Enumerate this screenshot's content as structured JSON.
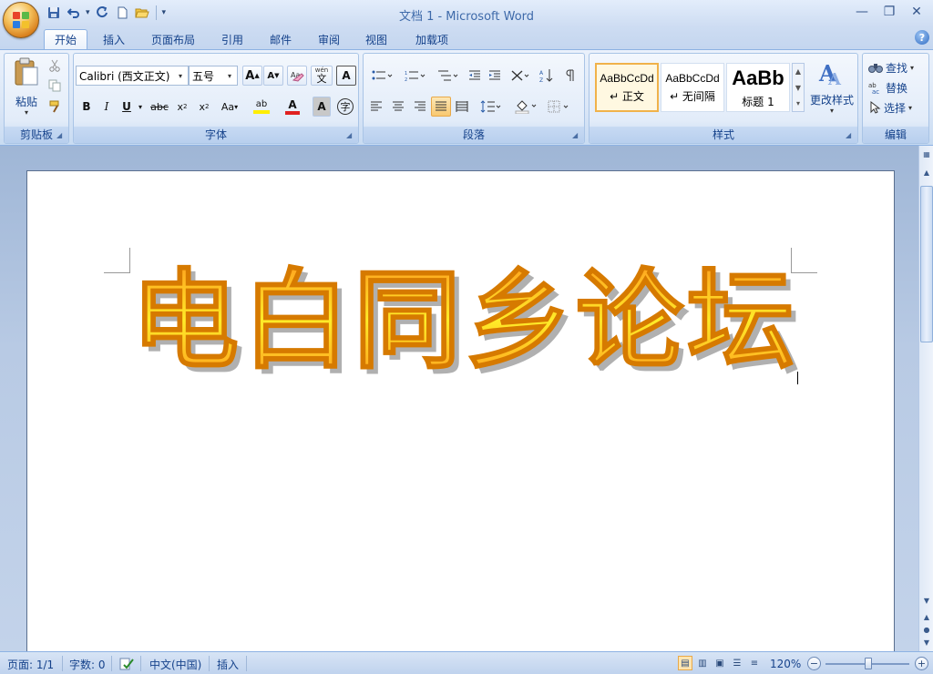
{
  "window": {
    "title": "文档 1 - Microsoft Word",
    "minimize": "—",
    "restore": "❐",
    "close": "✕"
  },
  "qat": {
    "icons": [
      "save-icon",
      "undo-icon",
      "redo-icon",
      "new-document-icon",
      "open-folder-icon"
    ]
  },
  "tabs": [
    {
      "label": "开始",
      "active": true
    },
    {
      "label": "插入"
    },
    {
      "label": "页面布局"
    },
    {
      "label": "引用"
    },
    {
      "label": "邮件"
    },
    {
      "label": "审阅"
    },
    {
      "label": "视图"
    },
    {
      "label": "加载项"
    }
  ],
  "help": "?",
  "clipboard": {
    "group_label": "剪贴板",
    "paste_label": "粘贴"
  },
  "font": {
    "group_label": "字体",
    "font_name": "Calibri (西文正文)",
    "font_size": "五号",
    "grow": "A",
    "shrink": "A",
    "phonetic": "wén",
    "char_border": "A",
    "bold": "B",
    "italic": "I",
    "underline": "U",
    "strikethrough": "abc",
    "subscript": "x",
    "superscript": "x",
    "change_case": "Aa",
    "highlight": "ab",
    "font_color": "A",
    "char_shading": "A",
    "enclose": "字",
    "font_color_hex": "#e02020",
    "highlight_hex": "#ffee00"
  },
  "paragraph": {
    "group_label": "段落"
  },
  "styles": {
    "group_label": "样式",
    "items": [
      {
        "sample": "AaBbCcDd",
        "name": "↵ 正文",
        "selected": true
      },
      {
        "sample": "AaBbCcDd",
        "name": "↵ 无间隔"
      },
      {
        "sample": "AaBb",
        "name": "标题 1"
      }
    ],
    "change_styles": "更改样式"
  },
  "editing": {
    "group_label": "编辑",
    "find": "查找",
    "replace": "替换",
    "select": "选择"
  },
  "document": {
    "wordart_text": "电白同乡论坛",
    "wordart_colors": {
      "top": "#ff9a1e",
      "middle": "#ffec28",
      "bottom": "#ff9a1e",
      "outline": "#d67a00",
      "shadow": "#b0b0b0"
    }
  },
  "statusbar": {
    "page": "页面: 1/1",
    "words": "字数: 0",
    "language": "中文(中国)",
    "insert_mode": "插入",
    "zoom": "120%",
    "zoom_out": "−",
    "zoom_in": "+"
  }
}
